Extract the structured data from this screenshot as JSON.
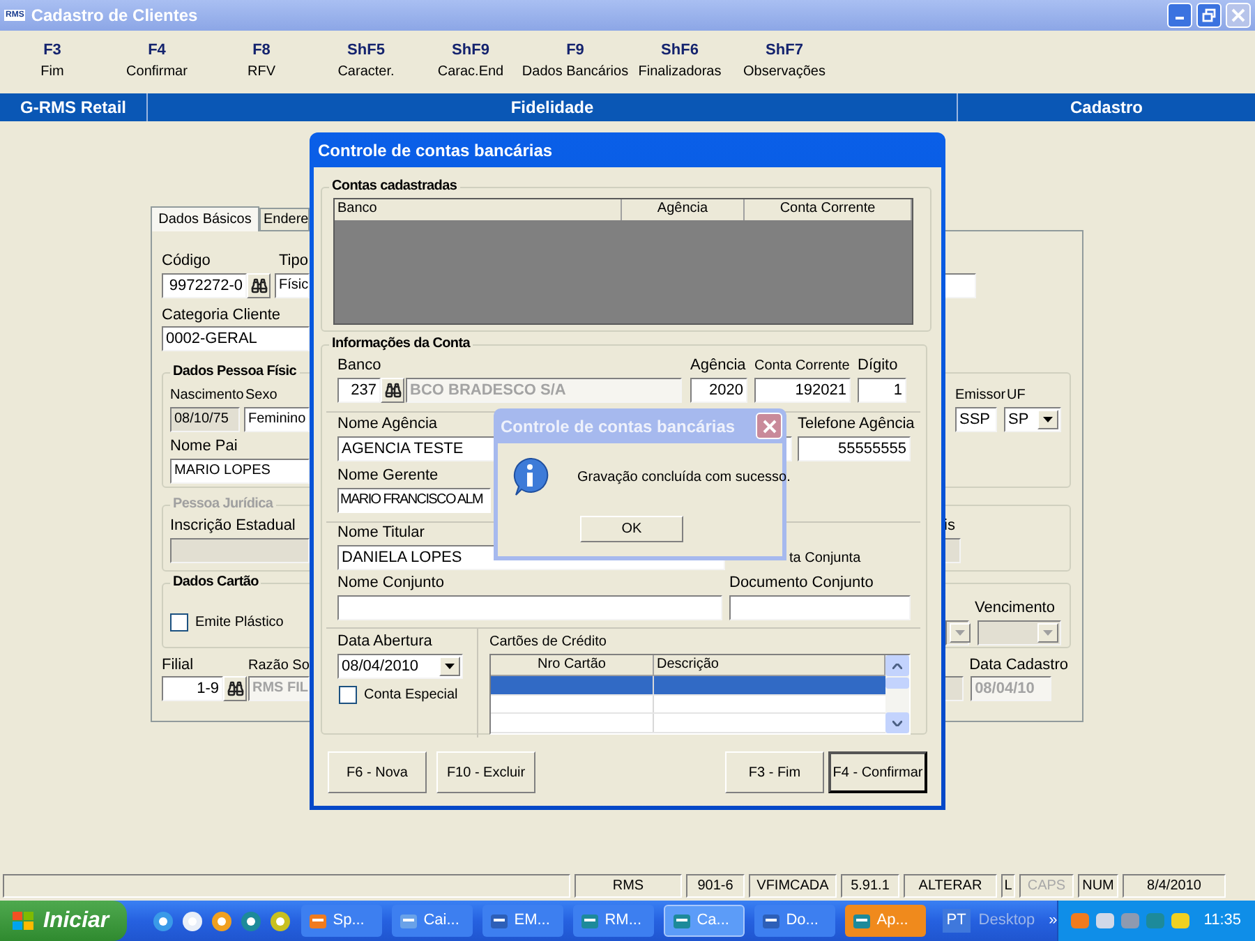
{
  "window": {
    "icon_text": "RMS",
    "title": "Cadastro de Clientes"
  },
  "toolbar": [
    {
      "key": "F3",
      "label": "Fim"
    },
    {
      "key": "F4",
      "label": "Confirmar"
    },
    {
      "key": "F8",
      "label": "RFV"
    },
    {
      "key": "ShF5",
      "label": "Caracter."
    },
    {
      "key": "ShF9",
      "label": "Carac.End"
    },
    {
      "key": "F9",
      "label": "Dados Bancários"
    },
    {
      "key": "ShF6",
      "label": "Finalizadoras"
    },
    {
      "key": "ShF7",
      "label": "Observações"
    }
  ],
  "header": {
    "app": "G-RMS Retail",
    "module": "Fidelidade",
    "screen": "Cadastro"
  },
  "client_form": {
    "tabs": [
      {
        "label": "Dados Básicos",
        "selected": true
      },
      {
        "label": "Endere",
        "selected": false
      }
    ],
    "codigo": {
      "label": "Código",
      "value": "9972272-0"
    },
    "tipo": {
      "label": "Tipo",
      "value": "Físic"
    },
    "categoria": {
      "label": "Categoria Cliente",
      "value": "0002-GERAL"
    },
    "pessoa_fisica": {
      "title": "Dados Pessoa Físic",
      "nascimento_label": "Nascimento",
      "sexo_label": "Sexo",
      "nascimento": {
        "value": "08/10/75",
        "readonly": true
      },
      "sexo": {
        "value": "Feminino"
      },
      "nome_pai": {
        "label": "Nome Pai",
        "value": "MARIO LOPES"
      },
      "emissor_label": "Emissor",
      "uf_label": "UF",
      "emissor": {
        "value": "SSP"
      },
      "uf": {
        "value": "SP"
      }
    },
    "pessoa_juridica": {
      "title": "Pessoa Jurídica",
      "disabled": true,
      "inscricao": {
        "label": "Inscrição Estadual",
        "disabled": true
      },
      "label_2": "is",
      "field_2": {
        "disabled": true
      }
    },
    "cartao": {
      "title": "Dados Cartão",
      "emite_plastico": {
        "label": "Emite Plástico",
        "checked": false
      },
      "vencimento_label": "Vencimento",
      "select_1": {
        "disabled": true
      },
      "select_2": {
        "disabled": true
      }
    },
    "filial": {
      "label": "Filial",
      "value": "1-9"
    },
    "razao_social": {
      "label": "Razão So",
      "value": "RMS FIL",
      "disabled": true
    },
    "field_3": {
      "disabled": true
    },
    "data_cadastro": {
      "label": "Data Cadastro",
      "value": "08/04/10",
      "disabled": true
    }
  },
  "bank_dialog": {
    "title": "Controle de contas bancárias",
    "accounts": {
      "title": "Contas cadastradas",
      "columns": [
        "Banco",
        "Agência",
        "Conta Corrente"
      ]
    },
    "info": {
      "title": "Informações da Conta",
      "banco": {
        "label": "Banco",
        "code": "237",
        "name": {
          "value": "BCO BRADESCO S/A",
          "disabled": true
        }
      },
      "agencia": {
        "label": "Agência",
        "value": "2020"
      },
      "conta": {
        "label": "Conta Corrente",
        "value": "192021"
      },
      "digito": {
        "label": "Dígito",
        "value": "1"
      },
      "nome_agencia": {
        "label": "Nome Agência",
        "value": "AGENCIA TESTE"
      },
      "telefone": {
        "label": "Telefone Agência",
        "value": "55555555"
      },
      "gerente": {
        "label": "Nome Gerente",
        "value": "MARIO FRANCISCO ALM"
      },
      "titular": {
        "label": "Nome Titular",
        "value": "DANIELA LOPES"
      },
      "conta_conjunta_label": "ta Conjunta",
      "nome_conjunto": {
        "label": "Nome Conjunto"
      },
      "documento_conjunto": {
        "label": "Documento Conjunto"
      },
      "data_abertura": {
        "label": "Data Abertura",
        "value": "08/04/2010"
      },
      "conta_especial": {
        "label": "Conta Especial",
        "checked": false
      },
      "cards": {
        "title": "Cartões de Crédito",
        "columns": [
          "Nro Cartão",
          "Descrição"
        ],
        "rows": [
          {
            "selected": true
          },
          {
            "selected": false
          },
          {
            "selected": false
          }
        ]
      }
    },
    "buttons": [
      {
        "label": "F6 - Nova",
        "default": false
      },
      {
        "label": "F10 - Excluir",
        "default": false
      },
      {
        "label": "F3 - Fim",
        "default": false
      },
      {
        "label": "F4 - Confirmar",
        "default": true
      }
    ]
  },
  "message_box": {
    "title": "Controle de contas bancárias",
    "message": "Gravação concluída com sucesso.",
    "button": "OK"
  },
  "status_bar": [
    {
      "text": "RMS",
      "disabled": false
    },
    {
      "text": "901-6",
      "disabled": false
    },
    {
      "text": "VFIMCADA",
      "disabled": false
    },
    {
      "text": "5.91.1",
      "disabled": false
    },
    {
      "text": "ALTERAR",
      "disabled": false
    },
    {
      "text": "L",
      "disabled": false
    },
    {
      "text": "CAPS",
      "disabled": true
    },
    {
      "text": "NUM",
      "disabled": false
    },
    {
      "text": "8/4/2010",
      "disabled": false
    }
  ],
  "taskbar": {
    "start": "Iniciar",
    "tasks": [
      {
        "label": "Sp...",
        "selected": false,
        "flashing": false
      },
      {
        "label": "Cai...",
        "selected": false,
        "flashing": false
      },
      {
        "label": "EM...",
        "selected": false,
        "flashing": false
      },
      {
        "label": "RM...",
        "selected": false,
        "flashing": false
      },
      {
        "label": "Ca...",
        "selected": true,
        "flashing": false
      },
      {
        "label": "Do...",
        "selected": false,
        "flashing": false
      },
      {
        "label": "Ap...",
        "selected": false,
        "flashing": true
      }
    ],
    "language": "PT",
    "desktop": "Desktop",
    "chevron": "»",
    "clock": "11:35"
  }
}
